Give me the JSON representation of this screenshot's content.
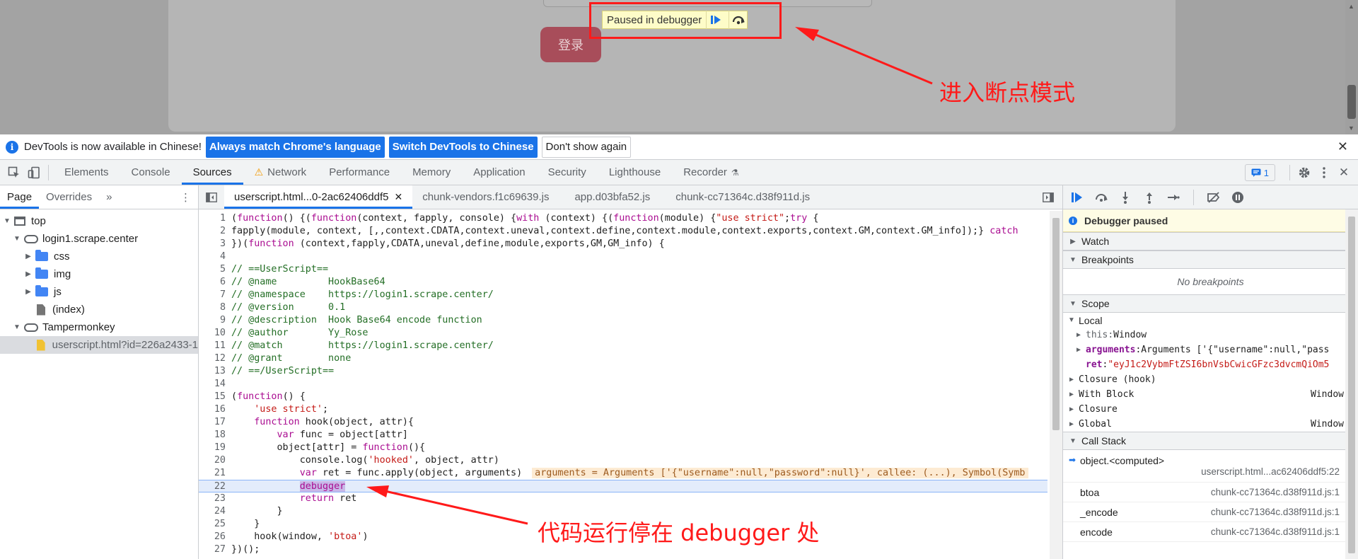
{
  "page": {
    "login_button": "登录",
    "paused_banner": "Paused in debugger"
  },
  "annotations": {
    "top": "进入断点模式",
    "bottom": "代码运行停在 debugger 处"
  },
  "notice": {
    "text": "DevTools is now available in Chinese!",
    "btn_match": "Always match Chrome's language",
    "btn_switch": "Switch DevTools to Chinese",
    "btn_dont": "Don't show again"
  },
  "devtools": {
    "tabs": [
      "Elements",
      "Console",
      "Sources",
      "Network",
      "Performance",
      "Memory",
      "Application",
      "Security",
      "Lighthouse",
      "Recorder"
    ],
    "issues_count": "1"
  },
  "navigator": {
    "tabs": [
      "Page",
      "Overrides"
    ],
    "tree": [
      "top",
      "login1.scrape.center",
      "css",
      "img",
      "js",
      "(index)",
      "Tampermonkey",
      "userscript.html?id=226a2433-1"
    ]
  },
  "editor": {
    "tabs": [
      "userscript.html...0-2ac62406ddf5",
      "chunk-vendors.f1c69639.js",
      "app.d03bfa52.js",
      "chunk-cc71364c.d38f911d.js"
    ],
    "inline_value": "arguments = Arguments ['{\"username\":null,\"password\":null}', callee: (...), Symbol(Symb"
  },
  "debugger": {
    "paused_msg": "Debugger paused",
    "watch": "Watch",
    "breakpoints": "Breakpoints",
    "no_breakpoints": "No breakpoints",
    "scope": "Scope",
    "local": "Local",
    "this_name": "this",
    "this_val": "Window",
    "args_name": "arguments",
    "args_val": "Arguments ['{\"username\":null,\"pass",
    "ret_name": "ret",
    "ret_val": "\"eyJ1c2VybmFtZSI6bnVsbCwicGFzc3dvcmQiOm5",
    "closure_hook": "Closure (hook)",
    "with_block": "With Block",
    "with_block_val": "Window",
    "closure": "Closure",
    "global": "Global",
    "global_val": "Window",
    "call_stack": "Call Stack",
    "frames": [
      {
        "fn": "object.<computed>",
        "loc": "userscript.html...ac62406ddf5:22"
      },
      {
        "fn": "btoa",
        "loc": "chunk-cc71364c.d38f911d.js:1"
      },
      {
        "fn": "_encode",
        "loc": "chunk-cc71364c.d38f911d.js:1"
      },
      {
        "fn": "encode",
        "loc": "chunk-cc71364c.d38f911d.js:1"
      }
    ]
  },
  "colors": {
    "accent": "#1a73e8",
    "annotation": "#ff1a1a",
    "paused_bg": "#fefcc8"
  }
}
